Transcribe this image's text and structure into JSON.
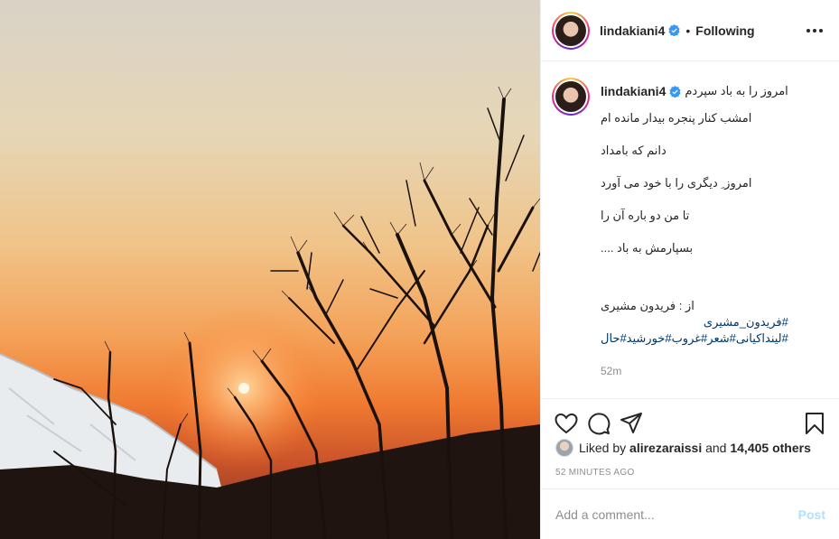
{
  "header": {
    "username": "lindakiani4",
    "follow_status": "Following",
    "separator": "•"
  },
  "caption": {
    "username": "lindakiani4",
    "first_line": "امروز را به باد سپردم",
    "lines": [
      "امشب کنار پنجره بیدار مانده ام",
      "دانم که بامداد",
      "امروز ِ دیگری را با خود می آورد",
      "تا من دو باره آن را",
      "بسپارمش به باد ...."
    ],
    "credit": "از : فریدون مشیری",
    "hashtag_line1": "#فریدون_مشیری",
    "hashtag_line2": "#لینداکیانی#شعر#غروب#خورشید#حال",
    "time": "52m"
  },
  "likes": {
    "prefix": "Liked by",
    "user": "alirezaraissi",
    "and": "and",
    "count": "14,405 others"
  },
  "posted_ago": "52 MINUTES AGO",
  "comment_box": {
    "placeholder": "Add a comment...",
    "post_label": "Post"
  },
  "colors": {
    "verified": "#3897f0",
    "link": "#00376b",
    "post_disabled": "#b2dffc"
  }
}
